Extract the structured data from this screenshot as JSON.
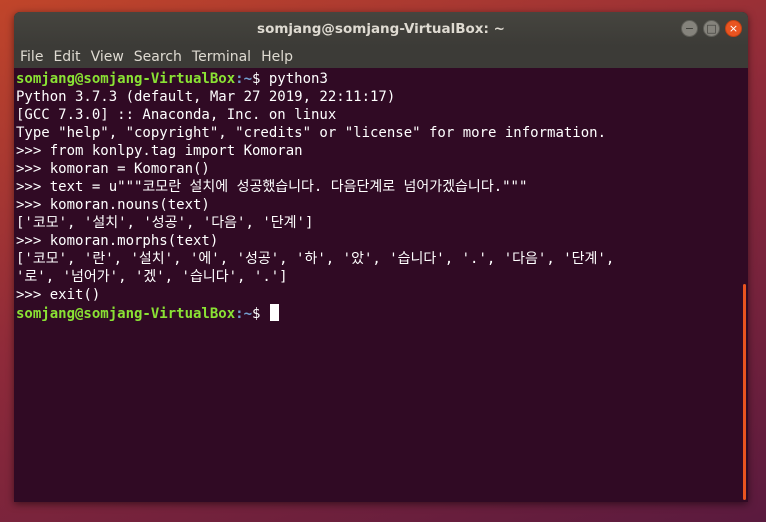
{
  "window": {
    "title": "somjang@somjang-VirtualBox: ~",
    "controls": {
      "minimize": "−",
      "maximize": "□",
      "close": "×"
    }
  },
  "menu": [
    "File",
    "Edit",
    "View",
    "Search",
    "Terminal",
    "Help"
  ],
  "prompt": {
    "user": "somjang@somjang-VirtualBox",
    "path": ":~",
    "symbol": "$ "
  },
  "terminal": {
    "first_command": "python3",
    "lines": [
      "Python 3.7.3 (default, Mar 27 2019, 22:11:17)",
      "[GCC 7.3.0] :: Anaconda, Inc. on linux",
      "Type \"help\", \"copyright\", \"credits\" or \"license\" for more information.",
      ">>> from konlpy.tag import Komoran",
      ">>> komoran = Komoran()",
      ">>> text = u\"\"\"코모란 설치에 성공했습니다. 다음단계로 넘어가겠습니다.\"\"\"",
      ">>> komoran.nouns(text)",
      "['코모', '설치', '성공', '다음', '단계']",
      ">>> komoran.morphs(text)",
      "['코모', '란', '설치', '에', '성공', '하', '았', '습니다', '.', '다음', '단계',",
      "'로', '넘어가', '겠', '습니다', '.']",
      ">>> exit()"
    ]
  },
  "colors": {
    "terminal_bg": "#300a24",
    "prompt_user": "#8ae234",
    "prompt_path": "#729fcf",
    "accent": "#e95420"
  }
}
